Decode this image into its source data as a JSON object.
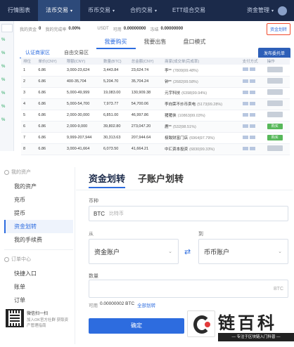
{
  "topnav": {
    "items": [
      {
        "label": "行情图表",
        "active": false
      },
      {
        "label": "法币交易",
        "active": true,
        "caret": true
      },
      {
        "label": "币币交易",
        "active": false,
        "caret": true
      },
      {
        "label": "合约交易",
        "active": false,
        "caret": true
      },
      {
        "label": "ETT组合交易",
        "active": false
      }
    ],
    "right_label": "资金管理",
    "right_caret": "▾"
  },
  "left_strip": {
    "values": [
      "%",
      "%",
      "%",
      "%",
      "%",
      "%",
      "%"
    ]
  },
  "info_bar": {
    "label1": "我的资金",
    "value1": "0",
    "label2": "我的完成率",
    "value2": "0.00%",
    "label3": "USDT",
    "label4": "可用",
    "value4": "0.00000000",
    "label5": "冻结",
    "value5": "0.00000000",
    "transfer_link": "资金划转"
  },
  "sub_tabs": [
    {
      "label": "我要购买",
      "active": true
    },
    {
      "label": "我要出售",
      "active": false
    },
    {
      "label": "盘口模式",
      "active": false
    }
  ],
  "filters": [
    {
      "label": "认证商家区",
      "active": true
    },
    {
      "label": "自由交易区",
      "active": false
    }
  ],
  "post_button": "发布委托单",
  "table": {
    "headers": [
      "排位",
      "单价(CNY)",
      "限额(CNY)",
      "数量(BTC)",
      "总金额(CNY)",
      "商家(成交单|完成率)",
      "支付方式",
      "操作"
    ],
    "rows": [
      {
        "rank": "1",
        "price": "6.86",
        "limit": "3,000-23,624",
        "qty": "3,443.84",
        "total": "23,624.74",
        "merchant": "李**",
        "pct": "(7809|99.48%)",
        "action": "",
        "on": false
      },
      {
        "rank": "2",
        "price": "6.86",
        "limit": "400-35,704",
        "qty": "5,204.70",
        "total": "35,704.24",
        "merchant": "钟**",
        "pct": "(2682|99.58%)",
        "action": "",
        "on": false
      },
      {
        "rank": "3",
        "price": "6.86",
        "limit": "5,000-49,999",
        "qty": "19,083.00",
        "total": "130,909.38",
        "merchant": "元宇科技",
        "pct": "(6398|99.94%)",
        "action": "",
        "on": false
      },
      {
        "rank": "4",
        "price": "6.86",
        "limit": "5,000-54,700",
        "qty": "7,973.77",
        "total": "54,700.06",
        "merchant": "李向荣不炒币卖电",
        "pct": "(5173|99.28%)",
        "action": "",
        "on": false
      },
      {
        "rank": "5",
        "price": "6.86",
        "limit": "2,000-30,000",
        "qty": "6,851.00",
        "total": "46,997.86",
        "merchant": "猪猪侠",
        "pct": "(10863|99.03%)",
        "action": "",
        "on": false
      },
      {
        "rank": "6",
        "price": "6.86",
        "limit": "2,000-9,000",
        "qty": "39,802.80",
        "total": "273,047.20",
        "merchant": "鹿**",
        "pct": "(532|98.51%)",
        "action": "购买",
        "on": true
      },
      {
        "rank": "7",
        "price": "6.86",
        "limit": "9,999-207,944",
        "qty": "30,313.63",
        "total": "207,944.64",
        "merchant": "极致财富门店",
        "pct": "(6964|97.79%)",
        "action": "购买",
        "on": true
      },
      {
        "rank": "8",
        "price": "6.86",
        "limit": "3,000-41,664",
        "qty": "6,073.50",
        "total": "41,664.21",
        "merchant": "中汇资本投资",
        "pct": "(6830|99.33%)",
        "action": "",
        "on": false
      }
    ]
  },
  "sidebar": {
    "section1": "我的资产",
    "items1": [
      {
        "label": "我的资产",
        "active": false
      },
      {
        "label": "充币",
        "active": false
      },
      {
        "label": "提币",
        "active": false
      },
      {
        "label": "资金划转",
        "active": true
      },
      {
        "label": "我的手续费",
        "active": false
      }
    ],
    "section2": "订单中心",
    "items2": [
      {
        "label": "快捷入口",
        "active": false
      },
      {
        "label": "账单",
        "active": false
      },
      {
        "label": "订单",
        "active": false
      }
    ],
    "qr_title": "微信扫一扫",
    "qr_desc": "加入OK官方社群 获取资产管理指南"
  },
  "transfer": {
    "tabs": [
      {
        "label": "资金划转",
        "active": true
      },
      {
        "label": "子账户划转",
        "active": false
      }
    ],
    "coin_label": "币种",
    "coin_value": "BTC",
    "coin_placeholder": "比特币",
    "from_label": "从",
    "from_value": "资金账户",
    "to_label": "到",
    "to_value": "币币账户",
    "swap_icon": "⇄",
    "amount_label": "数量",
    "amount_unit": "BTC",
    "available_label": "可用",
    "available_value": "0.00000002 BTC",
    "all_link": "全部划转",
    "confirm": "确定"
  },
  "watermark": {
    "brand": "链百科",
    "tagline": "— 专注于区块链入门科普 —"
  }
}
